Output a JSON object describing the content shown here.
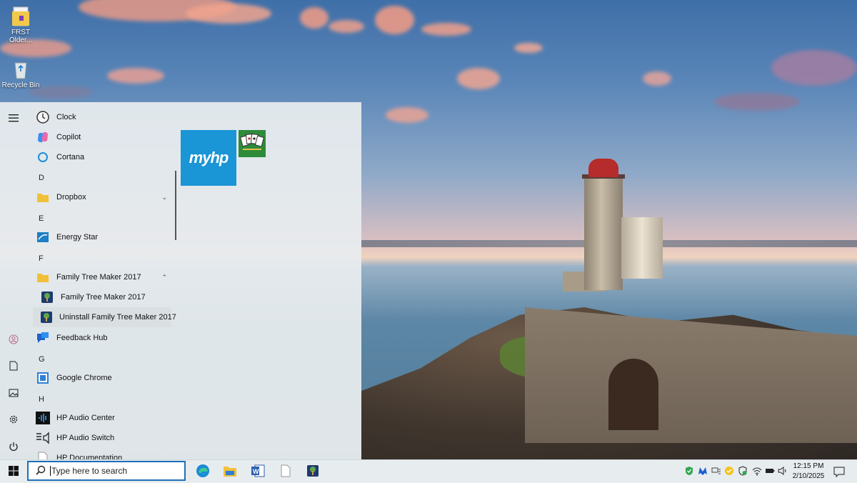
{
  "desktop": {
    "icons": [
      {
        "label": "FRST Older...",
        "icon": "folder-icon"
      },
      {
        "label": "Recycle Bin",
        "icon": "recycle-bin-icon"
      }
    ]
  },
  "start_menu": {
    "rail": [
      {
        "icon": "hamburger-menu-icon"
      },
      {
        "icon": "user-icon"
      },
      {
        "icon": "documents-icon"
      },
      {
        "icon": "pictures-icon"
      },
      {
        "icon": "settings-gear-icon"
      },
      {
        "icon": "power-icon"
      }
    ],
    "items": {
      "clock": "Clock",
      "copilot": "Copilot",
      "cortana": "Cortana",
      "letter_d": "D",
      "dropbox": "Dropbox",
      "letter_e": "E",
      "energy_star": "Energy Star",
      "letter_f": "F",
      "ftm_folder": "Family Tree Maker 2017",
      "ftm_app": "Family Tree Maker 2017",
      "ftm_uninstall": "Uninstall Family Tree Maker 2017",
      "feedback_hub": "Feedback Hub",
      "letter_g": "G",
      "chrome": "Google Chrome",
      "letter_h": "H",
      "hp_audio_center": "HP Audio Center",
      "hp_audio_switch": "HP Audio Switch",
      "hp_documentation": "HP Documentation"
    },
    "tiles": {
      "myhp": "myhp",
      "solitaire_icon": "solitaire-cards-icon"
    }
  },
  "taskbar": {
    "search_placeholder": "Type here to search",
    "pinned": [
      "edge-icon",
      "file-explorer-icon",
      "word-icon",
      "notepad-icon",
      "family-tree-maker-icon"
    ],
    "tray": [
      "security-shield-icon",
      "malwarebytes-icon",
      "display-icon",
      "norton-icon",
      "defender-icon",
      "wifi-icon",
      "battery-icon",
      "volume-icon"
    ],
    "time": "12:15 PM",
    "date": "2/10/2025"
  },
  "colors": {
    "accent": "#1f6fb8",
    "myhp_tile": "#1a95d6"
  }
}
